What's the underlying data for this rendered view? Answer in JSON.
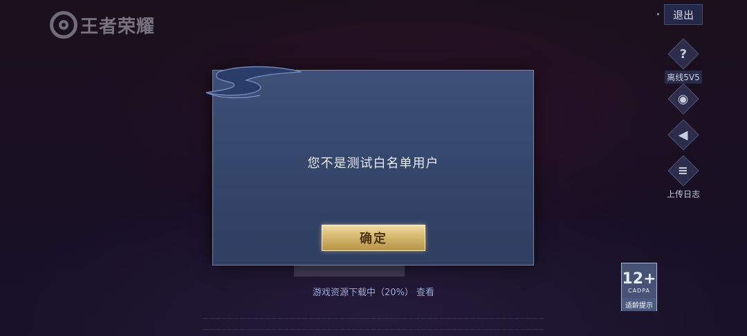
{
  "header": {
    "logo_text": "王者荣耀",
    "exit_label": "退出"
  },
  "side_menu": {
    "help_label": "离线5V5",
    "log_label": "上传日志"
  },
  "dialog": {
    "message": "您不是测试白名单用户",
    "confirm_label": "确定"
  },
  "download": {
    "status_text": "游戏资源下载中（20%）",
    "view_label": "查看",
    "progress_percent": 20
  },
  "age_rating": {
    "value": "12+",
    "org": "CADPA",
    "label": "适龄提示"
  },
  "colors": {
    "dialog_bg": "#3a4a70",
    "confirm_gold": "#d6b86e",
    "accent_blue": "#6f86b8"
  }
}
